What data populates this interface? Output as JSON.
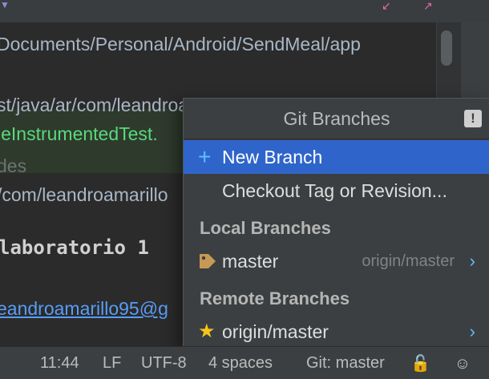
{
  "editor": {
    "path_line": "Documents/Personal/Android/SendMeal/app",
    "line_test_path": "st/java/ar/com/leandroamarillo/sendmeal/",
    "line_test_class": "leInstrumentedTest.",
    "line_des": "des",
    "line_com": "/com/leandroamarillo",
    "line_lab": "laboratorio 1",
    "line_email": "eandroamarillo95@g"
  },
  "popup": {
    "title": "Git Branches",
    "badge": "!",
    "items": {
      "new_branch": "New Branch",
      "checkout_tag": "Checkout Tag or Revision..."
    },
    "sections": {
      "local": {
        "header": "Local Branches",
        "branches": [
          {
            "name": "master",
            "tracking": "origin/master"
          }
        ]
      },
      "remote": {
        "header": "Remote Branches",
        "branches": [
          {
            "name": "origin/master"
          }
        ]
      }
    }
  },
  "statusbar": {
    "position": "11:44",
    "line_separator": "LF",
    "encoding": "UTF-8",
    "indent": "4 spaces",
    "git": "Git: master"
  },
  "colors": {
    "selection": "#2f65ca",
    "accent": "#5bc0ff",
    "star": "#f5c518",
    "tag": "#c69a54"
  },
  "icons": {
    "new_branch": "plus-icon",
    "local_branch": "tag-icon",
    "remote_branch": "star-icon",
    "statusbar_right_1": "lock-icon",
    "statusbar_right_2": "hector-icon"
  }
}
